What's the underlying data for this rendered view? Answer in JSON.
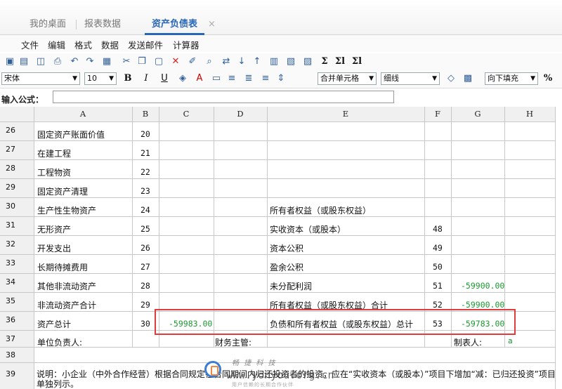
{
  "tabs": [
    {
      "label": "我的桌面"
    },
    {
      "label": "报表数据"
    },
    {
      "label": "资产负债表"
    }
  ],
  "tab_close": "×",
  "menu": [
    "文件",
    "编辑",
    "格式",
    "数据",
    "发送邮件",
    "计算器"
  ],
  "toolbar": {
    "font_name": "宋体",
    "font_size": "10",
    "merge_cells": "合并单元格",
    "border_style": "细线",
    "fill_direction": "向下填充",
    "percent": "%",
    "bold": "B",
    "italic": "I",
    "underline": "U",
    "sum1": "Σ",
    "sum2": "Σl",
    "sum3": "Σl"
  },
  "formula_bar": {
    "label": "输入公式：",
    "value": ""
  },
  "columns": [
    "A",
    "B",
    "C",
    "D",
    "E",
    "F",
    "G",
    "H"
  ],
  "rows": [
    {
      "n": "26",
      "A": "固定资产账面价值",
      "B": "20",
      "C": "",
      "E": "",
      "F": "",
      "G": ""
    },
    {
      "n": "27",
      "A": "在建工程",
      "B": "21",
      "C": "",
      "E": "",
      "F": "",
      "G": ""
    },
    {
      "n": "28",
      "A": "工程物资",
      "B": "22",
      "C": "",
      "E": "",
      "F": "",
      "G": ""
    },
    {
      "n": "29",
      "A": "固定资产清理",
      "B": "23",
      "C": "",
      "E": "",
      "F": "",
      "G": ""
    },
    {
      "n": "30",
      "A": "生产性生物资产",
      "B": "24",
      "C": "",
      "E": "所有者权益（或股东权益）",
      "F": "",
      "G": ""
    },
    {
      "n": "31",
      "A": "无形资产",
      "B": "25",
      "C": "",
      "E": "实收资本（或股本）",
      "F": "48",
      "G": ""
    },
    {
      "n": "32",
      "A": "开发支出",
      "B": "26",
      "C": "",
      "E": "资本公积",
      "F": "49",
      "G": ""
    },
    {
      "n": "33",
      "A": "长期待摊费用",
      "B": "27",
      "C": "",
      "E": "盈余公积",
      "F": "50",
      "G": ""
    },
    {
      "n": "34",
      "A": "其他非流动资产",
      "B": "28",
      "C": "",
      "E": "未分配利润",
      "F": "51",
      "G": "-59900.00"
    },
    {
      "n": "35",
      "A": "非流动资产合计",
      "B": "29",
      "C": "",
      "E": "所有者权益（或股东权益）合计",
      "F": "52",
      "G": "-59900.00"
    },
    {
      "n": "36",
      "A": "资产总计",
      "B": "30",
      "C": "-59983.00",
      "E": "负债和所有者权益（或股东权益）总计",
      "F": "53",
      "G": "-59783.00"
    }
  ],
  "row37": {
    "n": "37",
    "A": "单位负责人:",
    "D": "财务主管:",
    "G": "制表人:",
    "H": "a"
  },
  "row38": {
    "n": "38"
  },
  "row39": {
    "n": "39",
    "text": "说明：小企业（中外合作经营）根据合同规定在合同期间内归还投资者的投资，应在“实收资本（或股本）”项目下增加“减：已归还投资”项目单独列示。"
  },
  "watermark": {
    "cn": "畅 捷 科 技",
    "url": "www.yonyou.org.cn",
    "sub": "用户信赖的长期合作伙伴"
  }
}
